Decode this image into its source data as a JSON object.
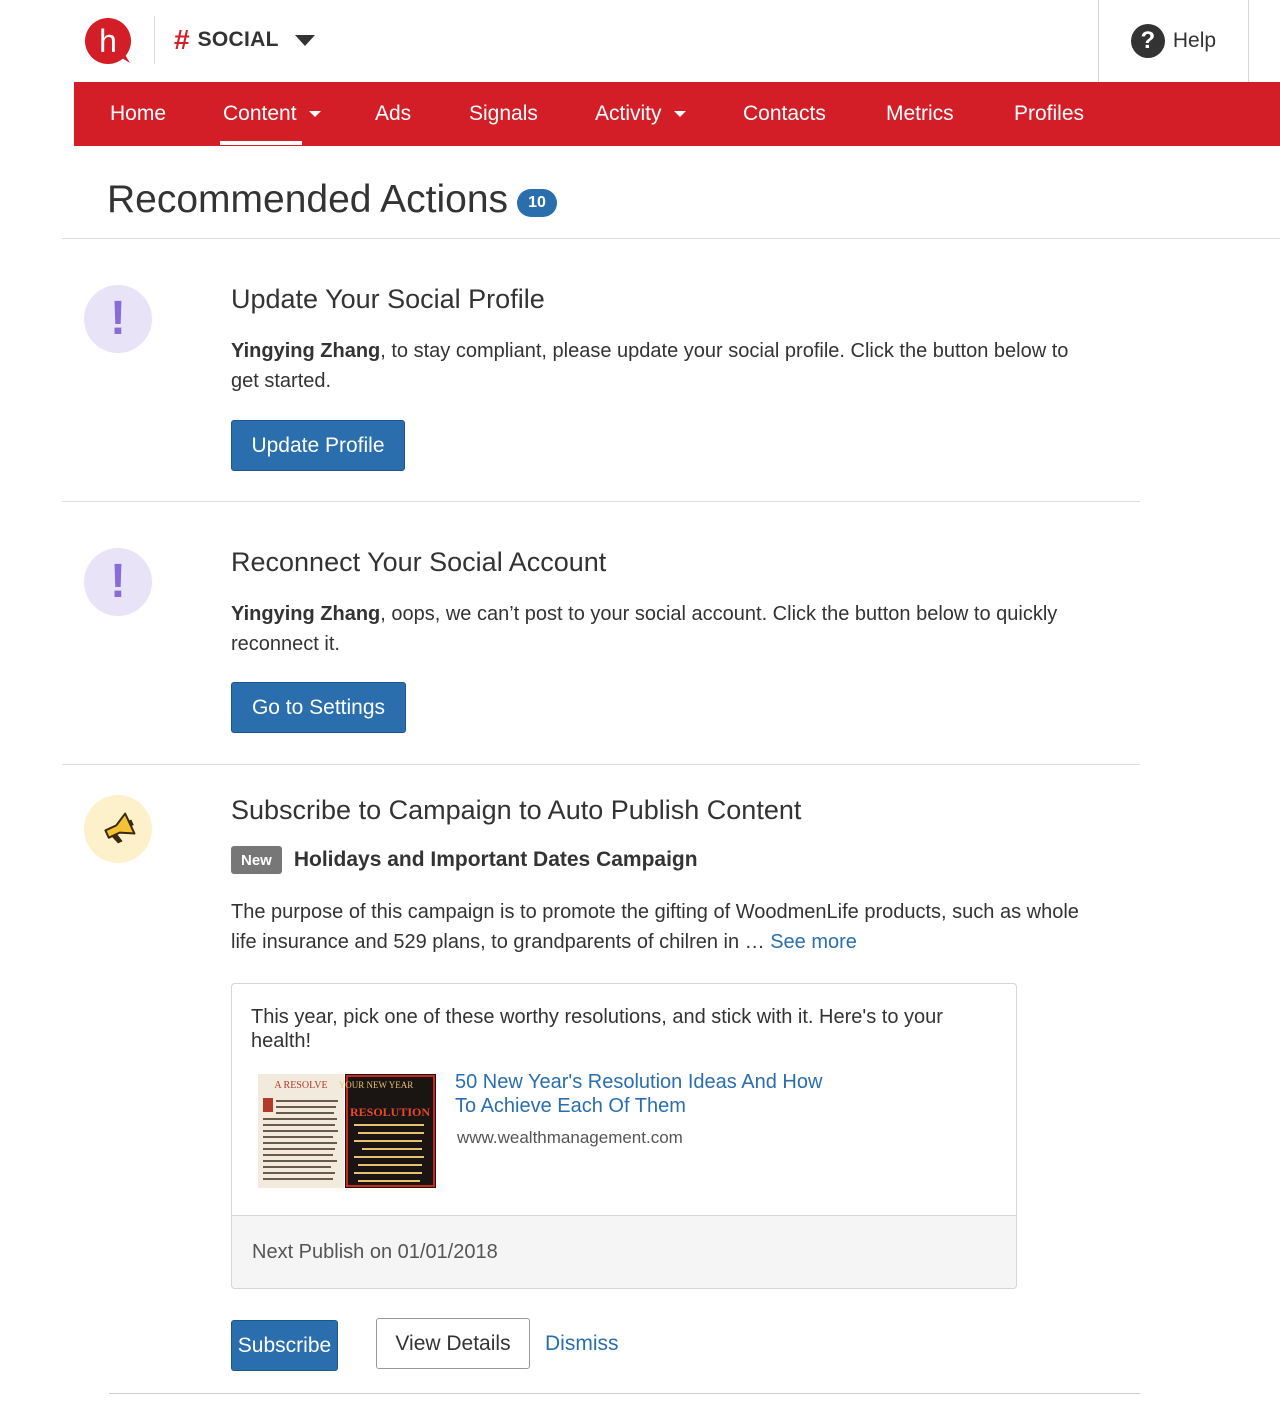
{
  "header": {
    "app_hash": "#",
    "app_name": "SOCIAL",
    "help_icon": "?",
    "help_label": "Help"
  },
  "nav": {
    "items": [
      {
        "label": "Home"
      },
      {
        "label": "Content",
        "has_dropdown": true,
        "active": true
      },
      {
        "label": "Ads"
      },
      {
        "label": "Signals"
      },
      {
        "label": "Activity",
        "has_dropdown": true
      },
      {
        "label": "Contacts"
      },
      {
        "label": "Metrics"
      },
      {
        "label": "Profiles"
      }
    ]
  },
  "page": {
    "title": "Recommended Actions",
    "count": "10"
  },
  "actions": [
    {
      "icon": "!",
      "title": "Update Your Social Profile",
      "user": "Yingying Zhang",
      "text": ", to stay compliant, please update your social profile. Click the button below to get started.",
      "button": "Update Profile"
    },
    {
      "icon": "!",
      "title": "Reconnect Your Social Account",
      "user": "Yingying Zhang",
      "text": ", oops, we can’t post to your social account. Click the button below to quickly reconnect it.",
      "button": "Go to Settings"
    }
  ],
  "campaign": {
    "title": "Subscribe to Campaign to Auto Publish Content",
    "badge": "New",
    "name": "Holidays and Important Dates Campaign",
    "description": "The purpose of this campaign is to promote the gifting of WoodmenLife products, such as whole life insurance and 529 plans, to grandparents of chilren in … ",
    "see_more": "See more",
    "post": {
      "text": "This year, pick one of these worthy resolutions, and stick with it. Here's to your health!",
      "link_title": "50 New Year's Resolution Ideas And How To Achieve Each Of Them",
      "domain": "www.wealthmanagement.com",
      "thumb_left_heading": "A RESOLVE",
      "thumb_right_heading": "YOUR NEW YEAR",
      "thumb_right_sub": "RESOLUTION",
      "next_publish": "Next Publish on 01/01/2018"
    },
    "subscribe_button": "Subscribe",
    "details_button": "View Details",
    "dismiss_link": "Dismiss"
  },
  "colors": {
    "brand_red": "#d31e27",
    "primary_blue": "#2a6ead",
    "alert_purple": "#8a6cd6",
    "megaphone_yellow": "#f5c232"
  }
}
